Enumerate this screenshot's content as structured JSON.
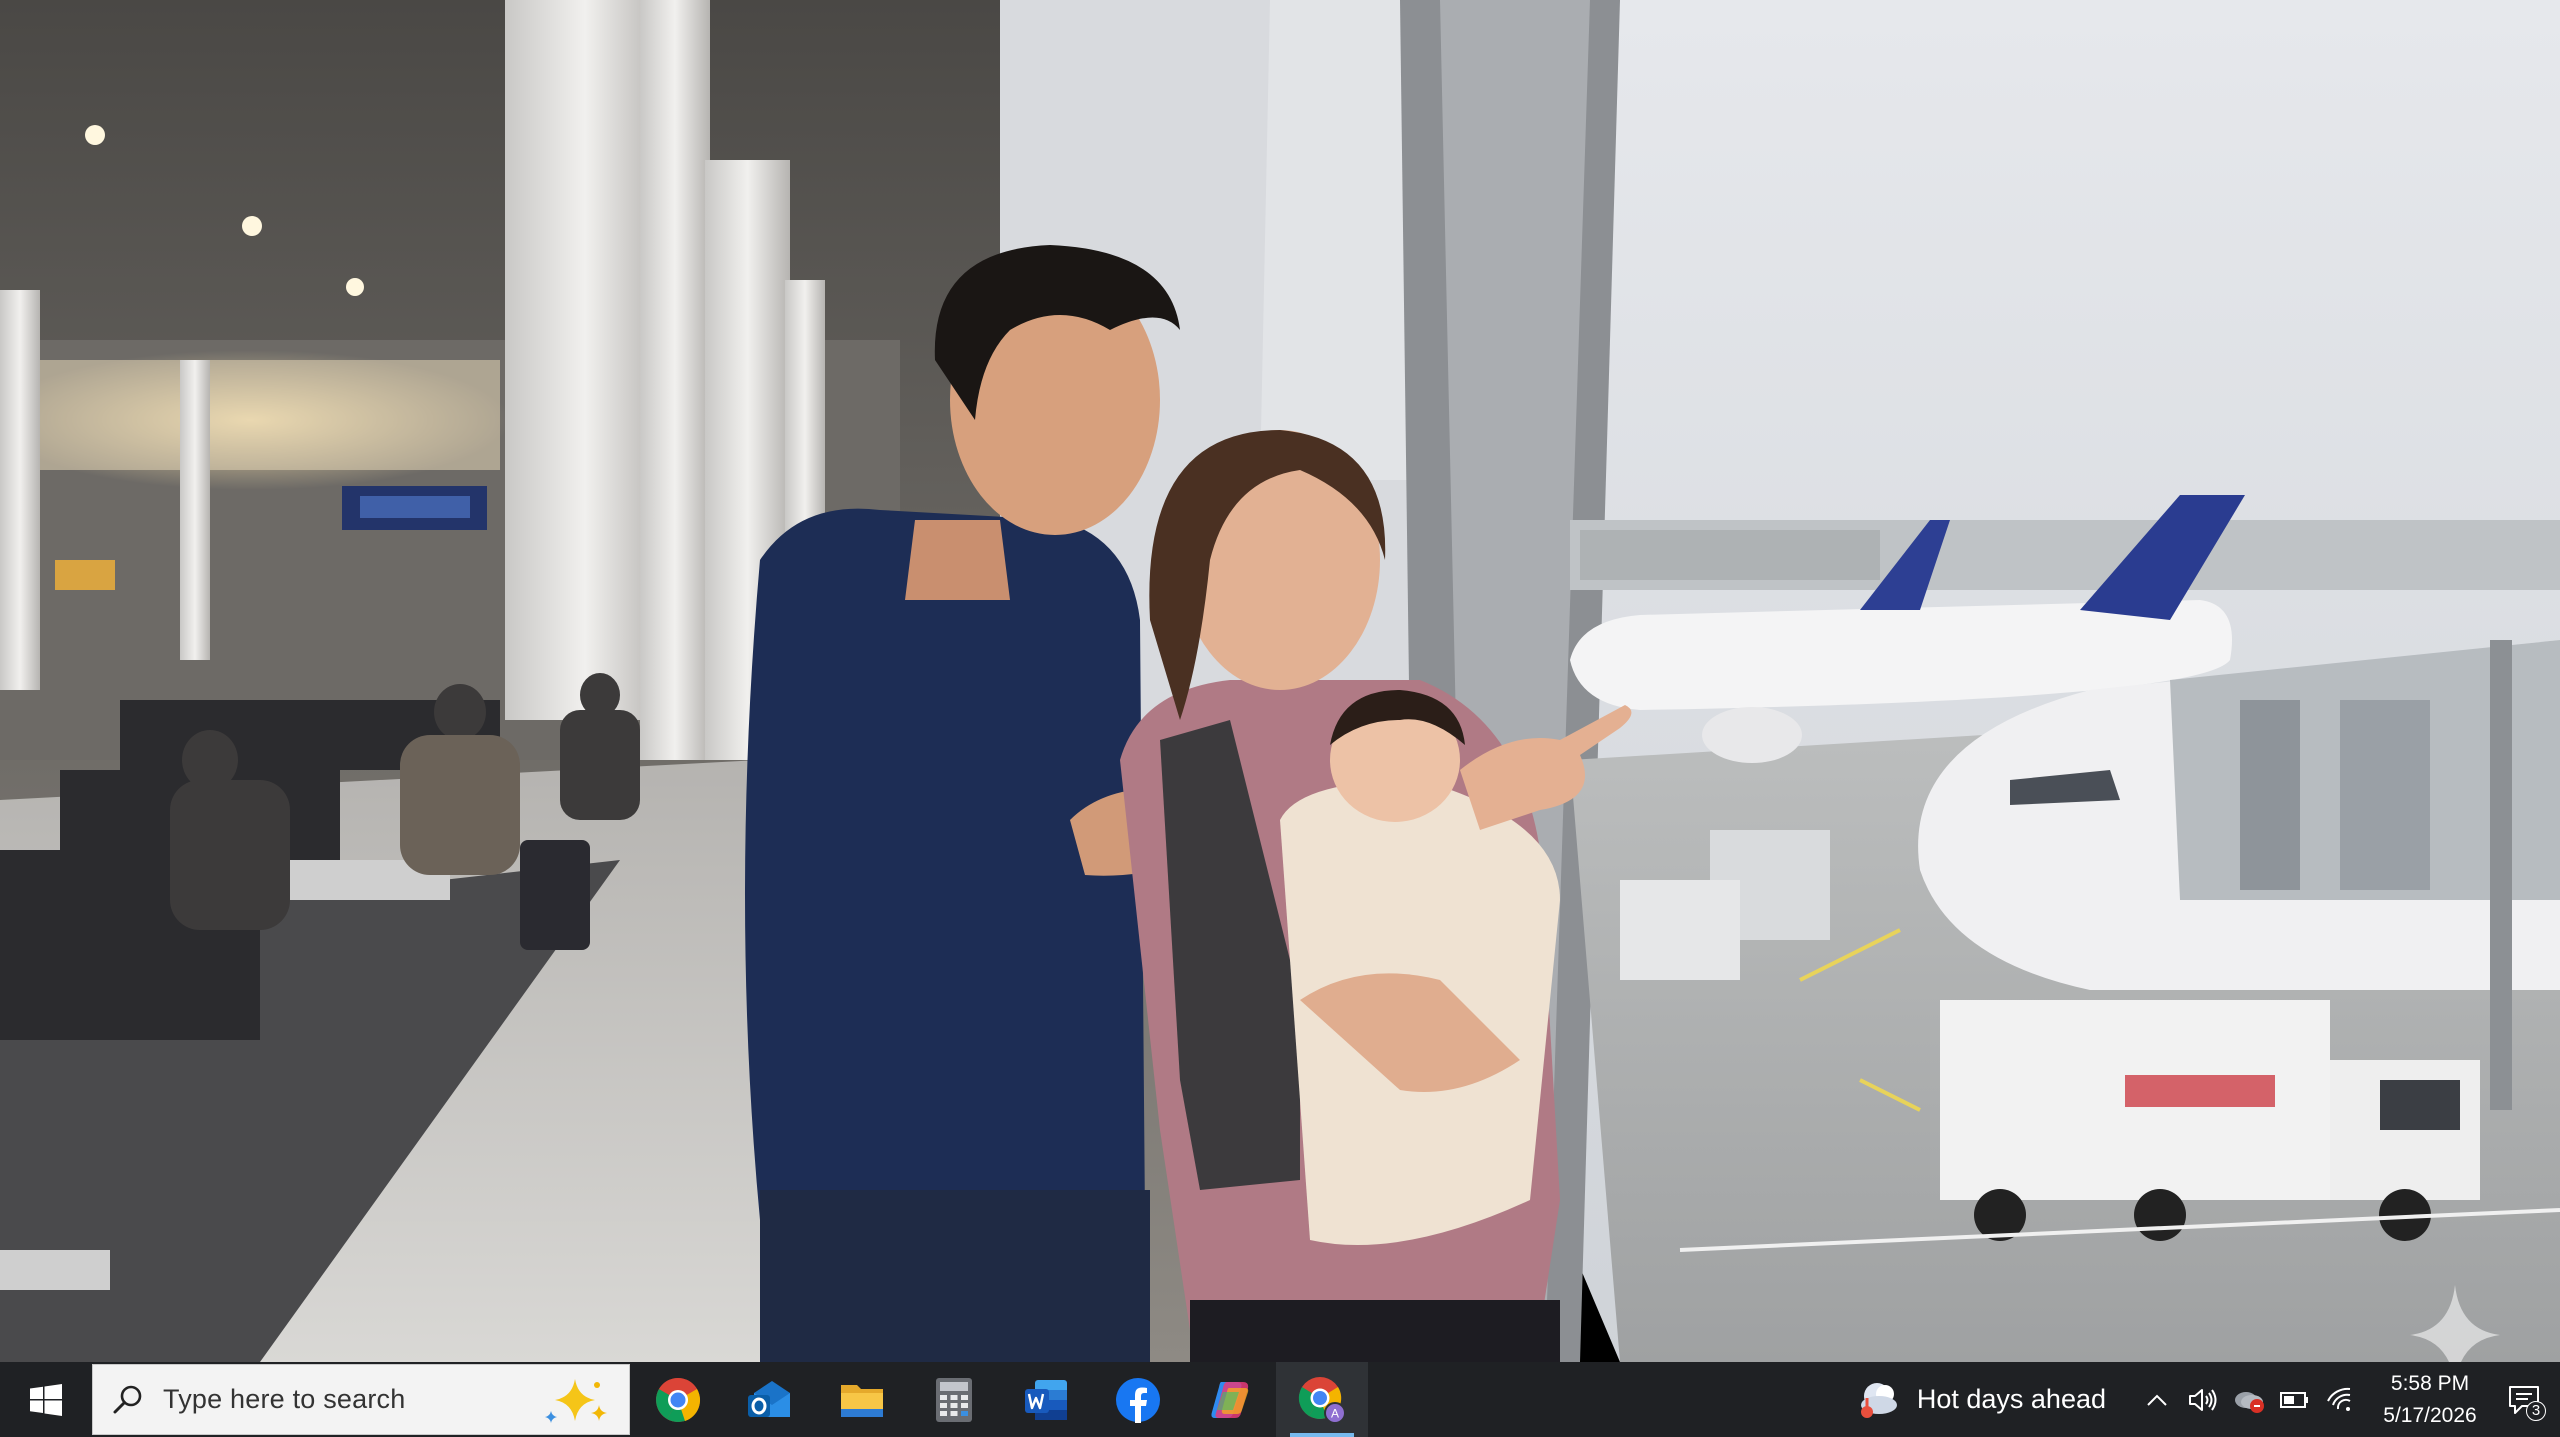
{
  "desktop": {
    "wallpaper": "family-at-airport-window-photo"
  },
  "taskbar": {
    "start_icon": "windows-logo-icon",
    "search": {
      "placeholder": "Type here to search"
    },
    "pinned_apps": [
      {
        "name": "Google Chrome",
        "icon": "chrome-icon"
      },
      {
        "name": "Outlook",
        "icon": "outlook-icon"
      },
      {
        "name": "File Explorer",
        "icon": "file-explorer-icon"
      },
      {
        "name": "Calculator",
        "icon": "calculator-icon"
      },
      {
        "name": "Word",
        "icon": "word-icon"
      },
      {
        "name": "Facebook",
        "icon": "facebook-icon"
      },
      {
        "name": "Copilot",
        "icon": "copilot-icon"
      },
      {
        "name": "Chrome Profile",
        "icon": "chrome-profile-icon",
        "active": true
      }
    ],
    "weather": {
      "text": "Hot days ahead",
      "icon": "weather-icon"
    },
    "tray_icons": [
      "chevron-up-icon",
      "volume-icon",
      "onedrive-icon",
      "battery-icon",
      "wifi-icon"
    ],
    "clock": {
      "time": "5:58 PM",
      "date": "5/17/2026"
    },
    "notifications": {
      "count": "3",
      "icon": "notification-icon"
    }
  },
  "colors": {
    "taskbar_bg": "#1f2124",
    "active_indicator": "#76b9ed"
  }
}
